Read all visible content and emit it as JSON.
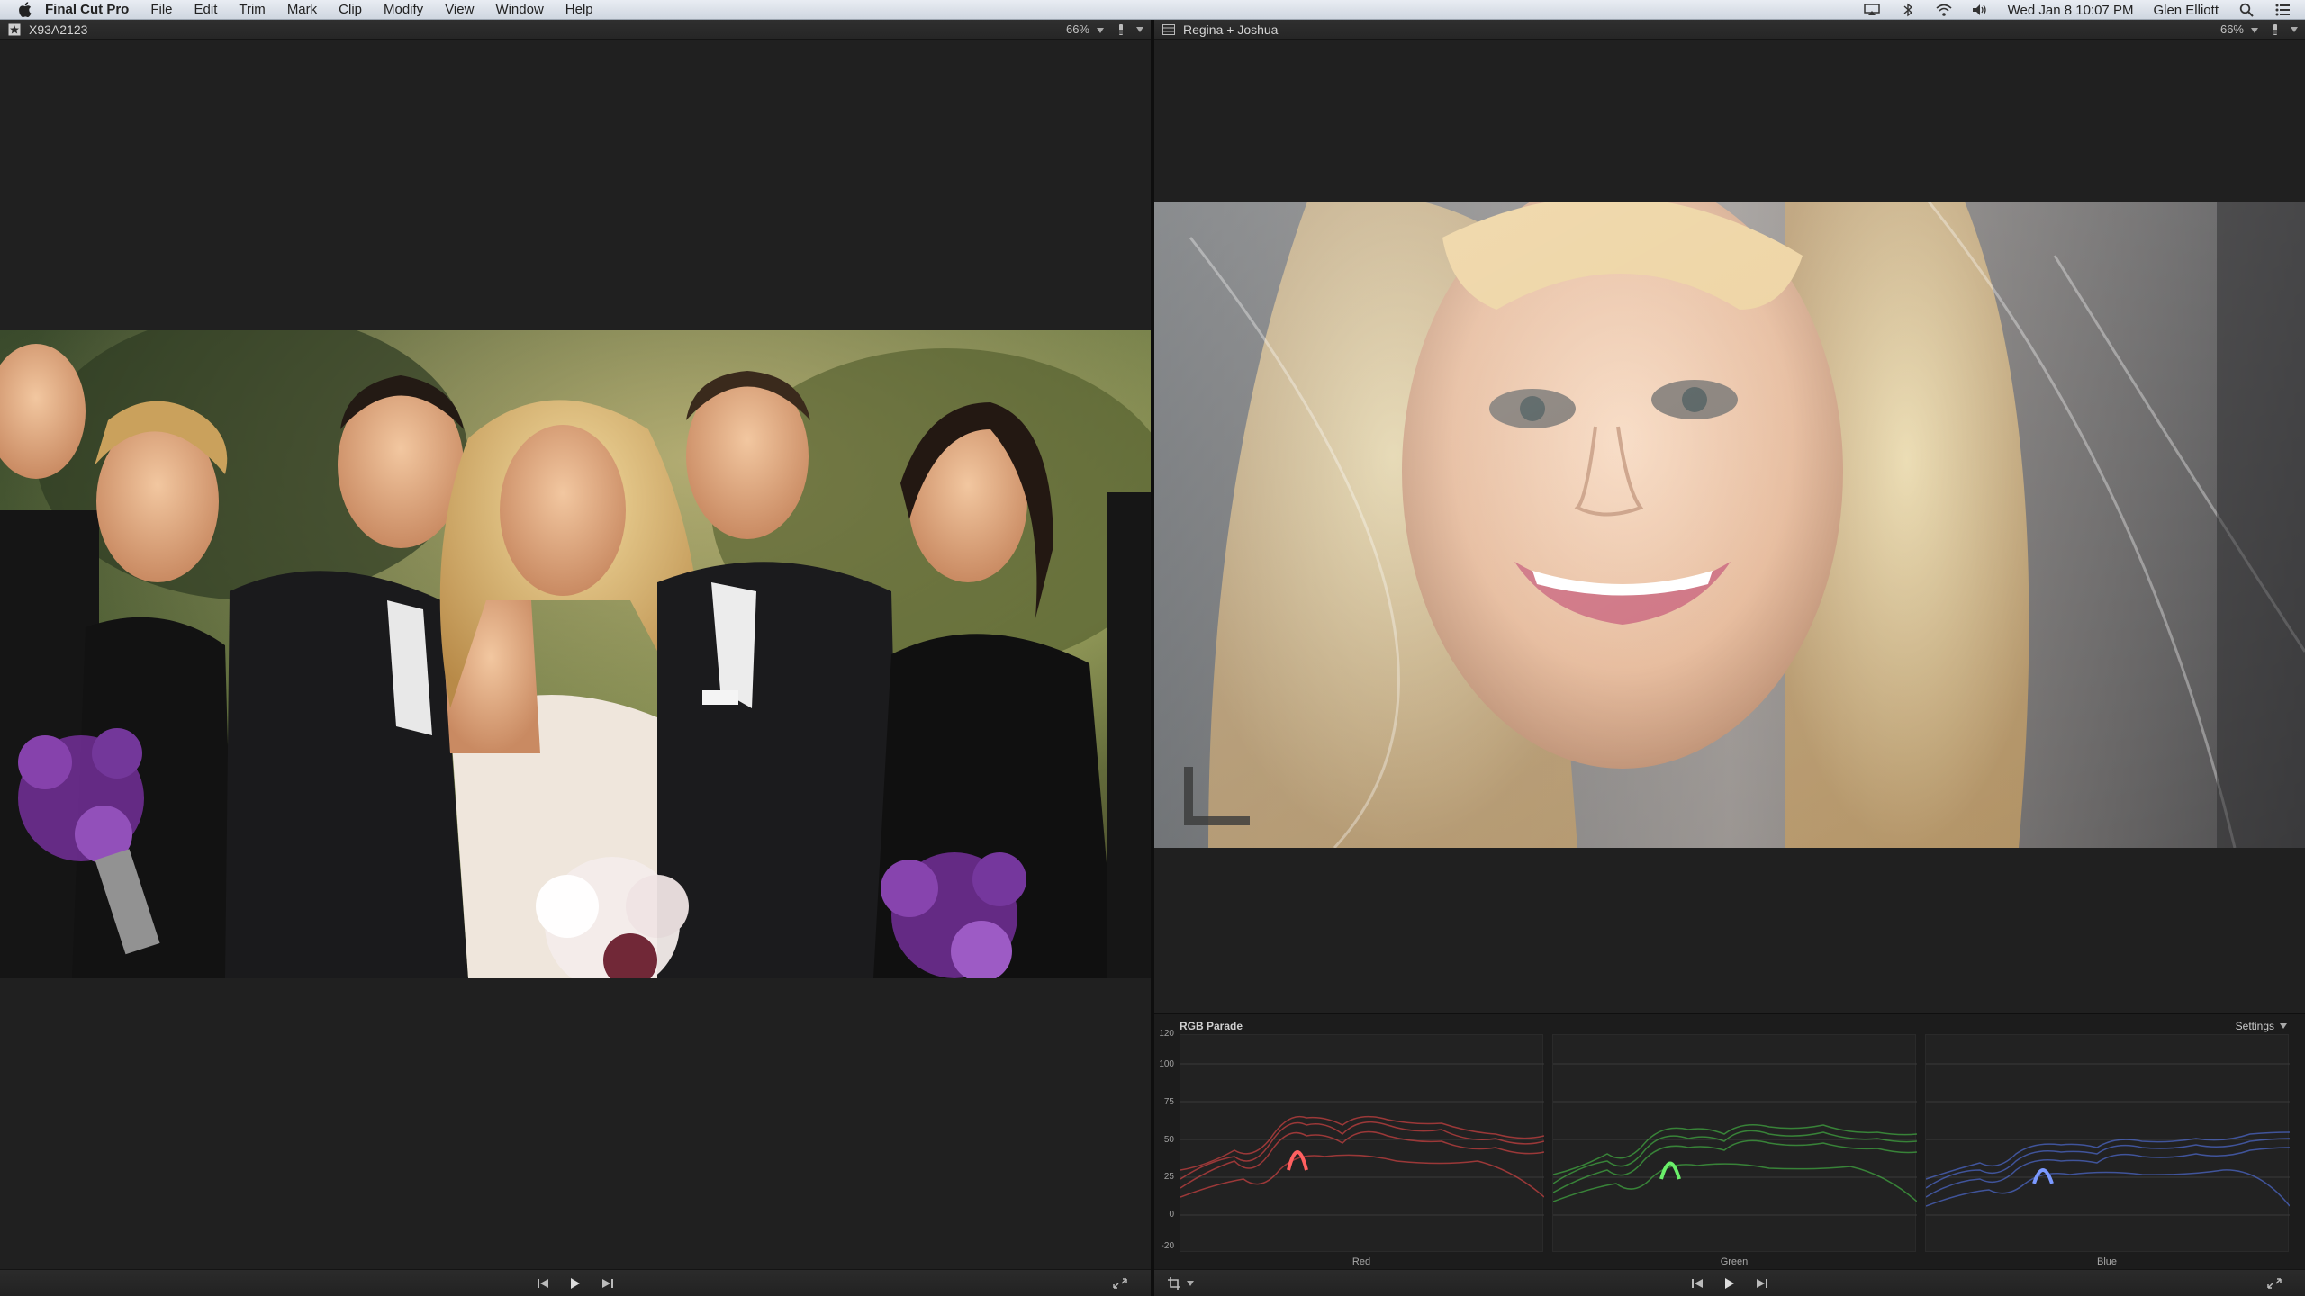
{
  "menubar": {
    "app_name": "Final Cut Pro",
    "menus": [
      "File",
      "Edit",
      "Trim",
      "Mark",
      "Clip",
      "Modify",
      "View",
      "Window",
      "Help"
    ],
    "datetime": "Wed Jan 8  10:07 PM",
    "user": "Glen Elliott"
  },
  "event_viewer": {
    "clip_name": "X93A2123",
    "zoom": "66%"
  },
  "timeline_viewer": {
    "project_name": "Regina + Joshua",
    "zoom": "66%"
  },
  "scopes": {
    "title": "RGB Parade",
    "settings_label": "Settings",
    "scale": [
      "120",
      "100",
      "75",
      "50",
      "25",
      "0",
      "-20"
    ],
    "channels": [
      {
        "name": "Red",
        "color": "#ff4b4b"
      },
      {
        "name": "Green",
        "color": "#4bd44b"
      },
      {
        "name": "Blue",
        "color": "#5a7dff"
      }
    ]
  },
  "colors": {
    "panel_bg": "#202020",
    "header_bg": "#2b2b2b",
    "menubar_bg": "#dfe4eb"
  }
}
